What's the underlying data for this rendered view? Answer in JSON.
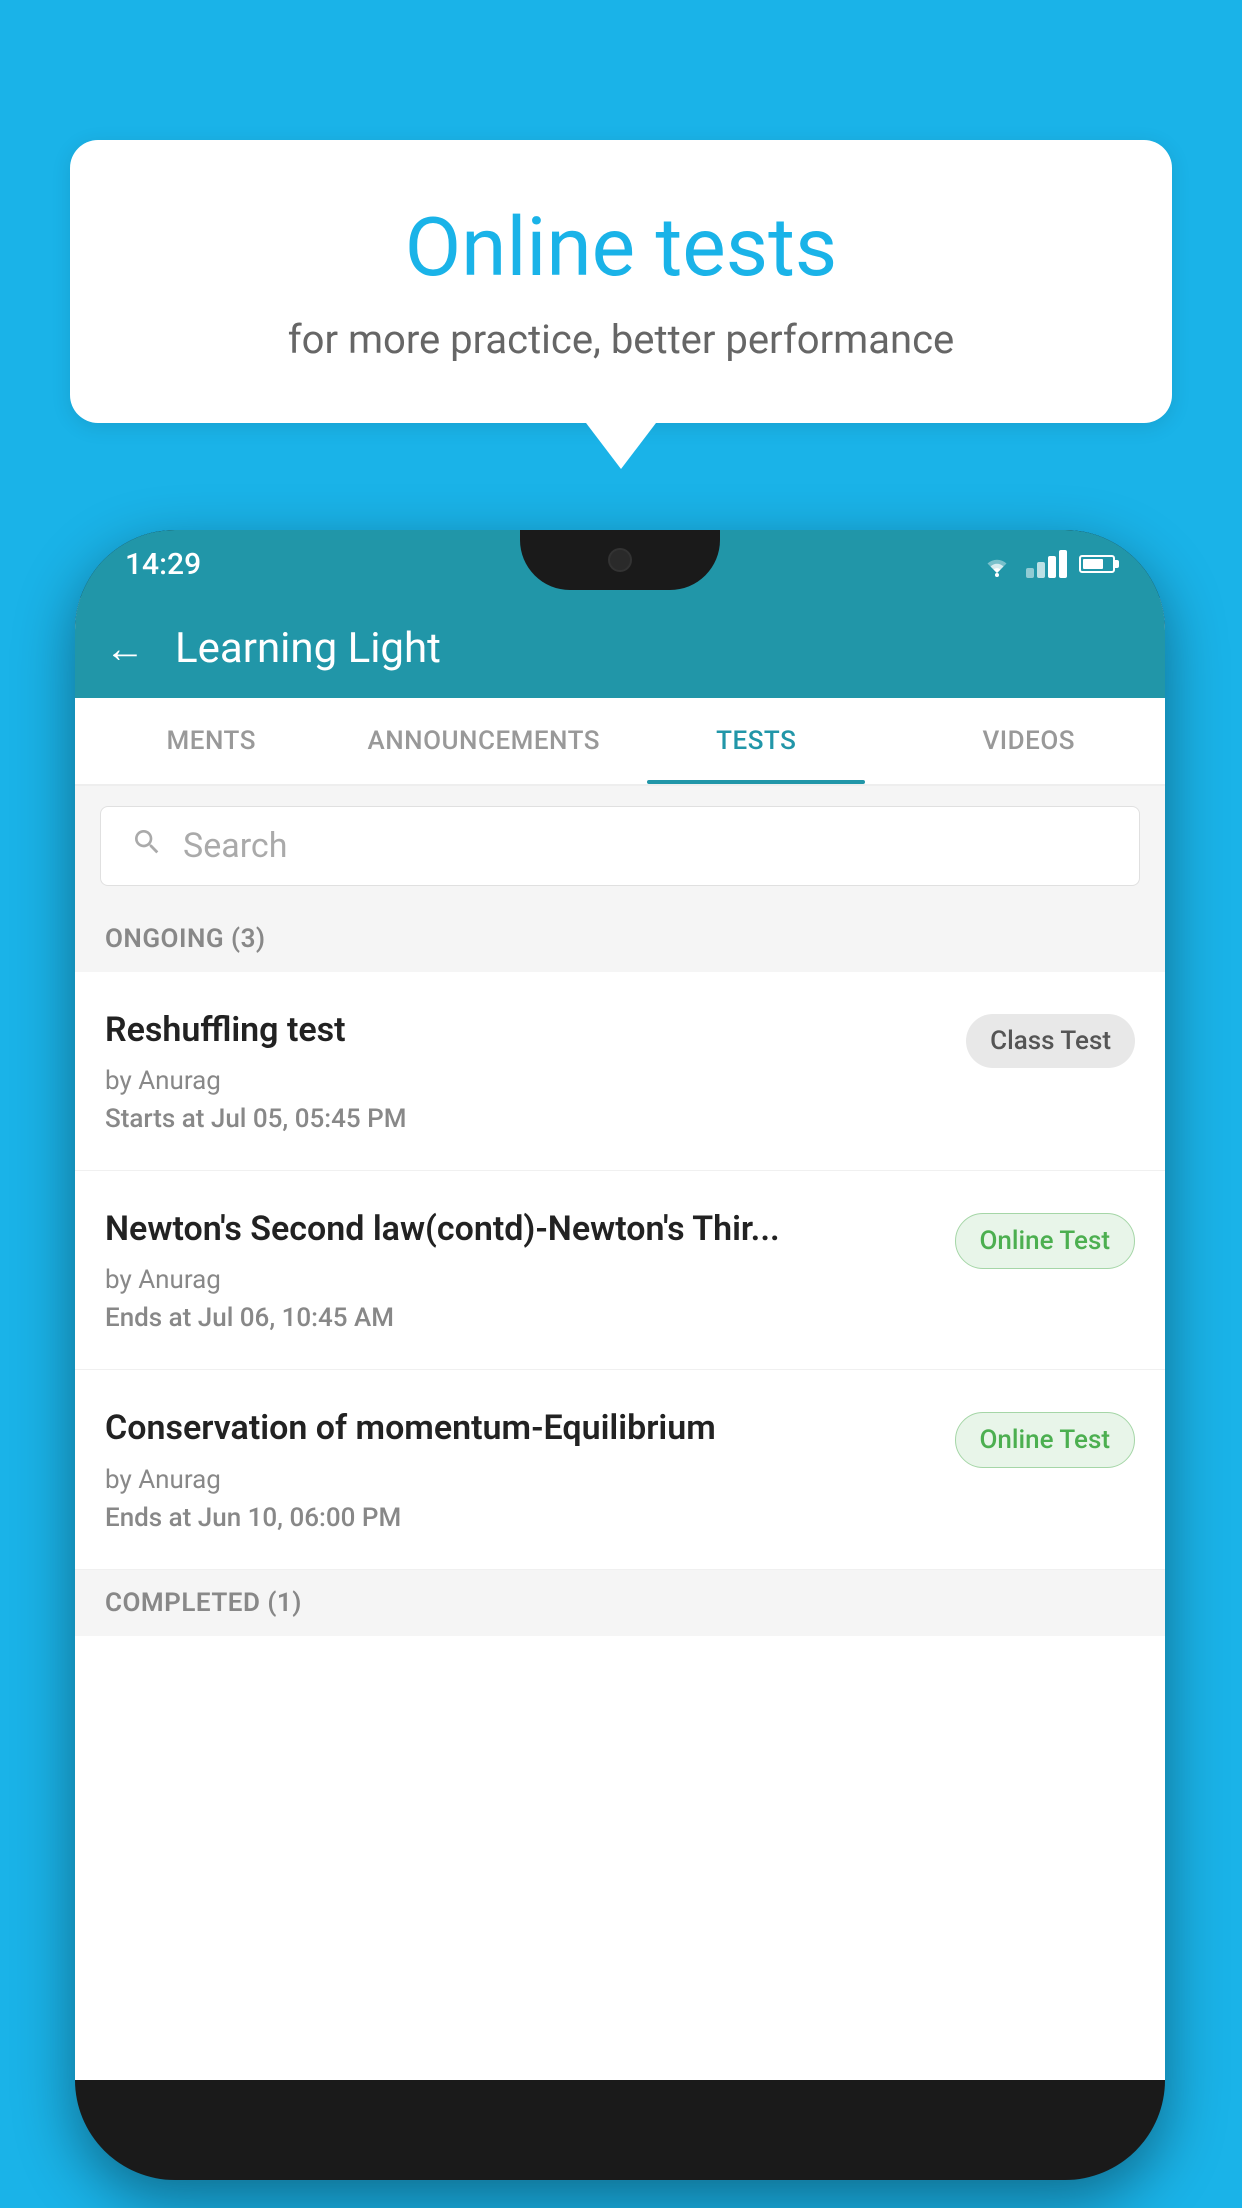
{
  "background": {
    "color": "#1ab3e8"
  },
  "speech_bubble": {
    "title": "Online tests",
    "subtitle": "for more practice, better performance"
  },
  "phone": {
    "status_bar": {
      "time": "14:29"
    },
    "app_bar": {
      "back_label": "←",
      "title": "Learning Light"
    },
    "tabs": [
      {
        "label": "MENTS",
        "active": false
      },
      {
        "label": "ANNOUNCEMENTS",
        "active": false
      },
      {
        "label": "TESTS",
        "active": true
      },
      {
        "label": "VIDEOS",
        "active": false
      }
    ],
    "search": {
      "placeholder": "Search"
    },
    "ongoing_section": {
      "header": "ONGOING (3)",
      "tests": [
        {
          "name": "Reshuffling test",
          "author": "by Anurag",
          "time_label": "Starts at",
          "time_value": "Jul 05, 05:45 PM",
          "badge": "Class Test",
          "badge_type": "class"
        },
        {
          "name": "Newton's Second law(contd)-Newton's Thir...",
          "author": "by Anurag",
          "time_label": "Ends at",
          "time_value": "Jul 06, 10:45 AM",
          "badge": "Online Test",
          "badge_type": "online"
        },
        {
          "name": "Conservation of momentum-Equilibrium",
          "author": "by Anurag",
          "time_label": "Ends at",
          "time_value": "Jun 10, 06:00 PM",
          "badge": "Online Test",
          "badge_type": "online"
        }
      ]
    },
    "completed_section": {
      "header": "COMPLETED (1)"
    }
  }
}
